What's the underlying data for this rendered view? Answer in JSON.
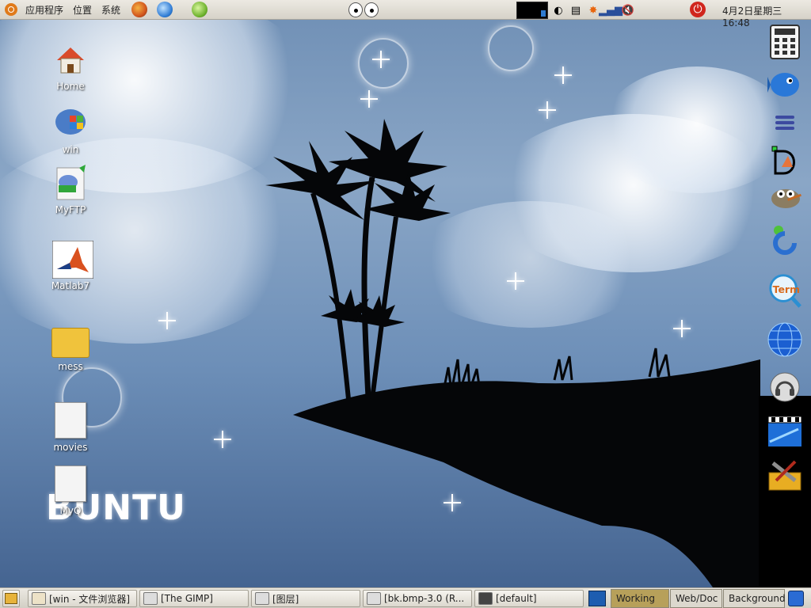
{
  "top_panel": {
    "menus": [
      "应用程序",
      "位置",
      "系统"
    ],
    "clock": "4月2日星期三 16:48"
  },
  "desktop_icons": [
    {
      "label": "Home"
    },
    {
      "label": "win"
    },
    {
      "label": "MyFTP",
      "badge": "FTP"
    },
    {
      "label": "Matlab7"
    },
    {
      "label": "mess"
    },
    {
      "label": "movies"
    },
    {
      "label": "MyQ"
    }
  ],
  "wallpaper": {
    "brand_text": "BUNTU"
  },
  "dock": {
    "items": [
      "calculator-icon",
      "fish-icon",
      "menu-icon",
      "inkscape-icon",
      "gimp-icon",
      "refresh-app-icon",
      "term-icon",
      "globe-icon",
      "headphones-icon",
      "media-icon",
      "tools-icon"
    ],
    "term_label": "Term"
  },
  "taskbar": {
    "windows": [
      {
        "label": "[win - 文件浏览器]"
      },
      {
        "label": "[The GIMP]"
      },
      {
        "label": "[图层]"
      },
      {
        "label": "[bk.bmp-3.0 (R..."
      },
      {
        "label": "[default]"
      }
    ],
    "workspaces": [
      "Working",
      "Web/Doc",
      "Background"
    ],
    "active_workspace": "Working"
  },
  "colors": {
    "panel": "#ece9e2",
    "active_ws": "#b7a05a"
  }
}
